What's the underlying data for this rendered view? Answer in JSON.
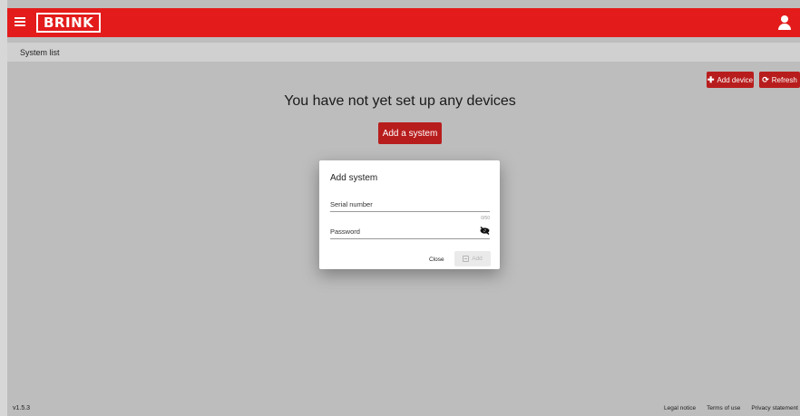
{
  "header": {
    "logo_text": "BRINK",
    "brand_color": "#e31b1b"
  },
  "breadcrumb": {
    "current": "System list"
  },
  "actions": {
    "add_device_label": "Add device",
    "refresh_label": "Refresh"
  },
  "empty_state": {
    "title": "You have not yet set up any devices",
    "add_system_label": "Add a system"
  },
  "modal": {
    "title": "Add system",
    "serial_label": "Serial number",
    "serial_value": "",
    "counter": "0/50",
    "password_label": "Password",
    "password_value": "",
    "close_label": "Close",
    "add_label": "Add"
  },
  "footer": {
    "version": "v1.5.3",
    "links": [
      "Legal notice",
      "Terms of use",
      "Privacy statement"
    ]
  },
  "icons": {
    "menu": "hamburger-icon",
    "user": "user-icon",
    "add": "plus-icon",
    "refresh": "refresh-icon",
    "visibility": "eye-slash-icon",
    "save": "save-icon"
  }
}
